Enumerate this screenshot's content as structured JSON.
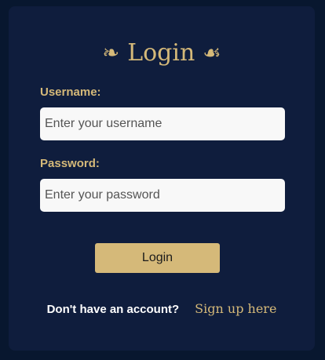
{
  "login": {
    "title": "Login",
    "ornament_left": "❧",
    "ornament_right": "☙",
    "username_label": "Username:",
    "username_placeholder": "Enter your username",
    "password_label": "Password:",
    "password_placeholder": "Enter your password",
    "submit_label": "Login",
    "signup_prompt": "Don't have an account?",
    "signup_link": "Sign up here"
  },
  "colors": {
    "background": "#08172f",
    "card": "#0f1d3d",
    "accent": "#d5b979",
    "input_bg": "#f8f8f8"
  }
}
